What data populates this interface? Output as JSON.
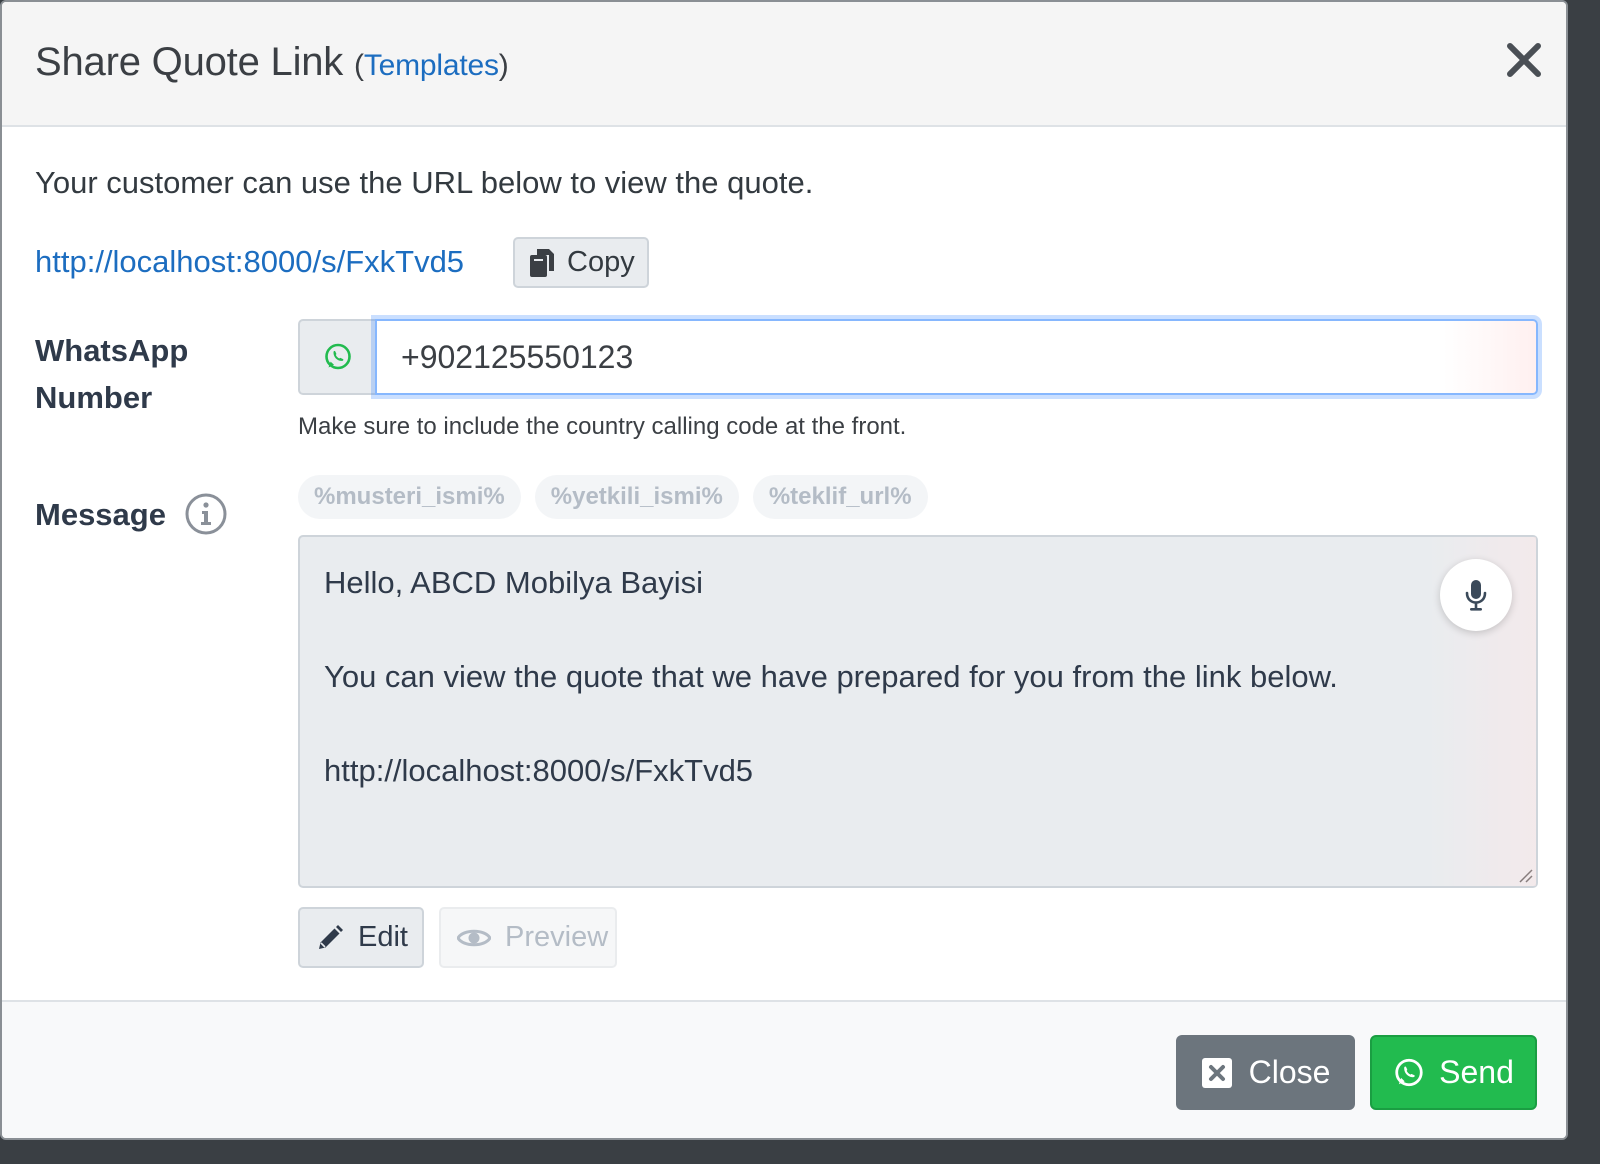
{
  "header": {
    "title": "Share Quote Link",
    "paren_open": "(",
    "templates_link": "Templates",
    "paren_close": ")"
  },
  "body": {
    "intro": "Your customer can use the URL below to view the quote.",
    "quote_url": "http://localhost:8000/s/FxkTvd5",
    "copy_label": "Copy"
  },
  "whatsapp": {
    "label_line1": "WhatsApp",
    "label_line2": "Number",
    "value": "+902125550123",
    "help": "Make sure to include the country calling code at the front."
  },
  "message": {
    "label": "Message",
    "placeholders": [
      "%musteri_ismi%",
      "%yetkili_ismi%",
      "%teklif_url%"
    ],
    "lines": [
      "Hello, ABCD Mobilya Bayisi",
      "",
      "You can view the quote that we have prepared for you from the link below.",
      "",
      "http://localhost:8000/s/FxkTvd5"
    ],
    "edit_label": "Edit",
    "preview_label": "Preview"
  },
  "footer": {
    "close_label": "Close",
    "send_label": "Send"
  },
  "colors": {
    "link": "#1c6dc0",
    "whatsapp_green": "#22bb4f",
    "secondary": "#6c757d"
  }
}
